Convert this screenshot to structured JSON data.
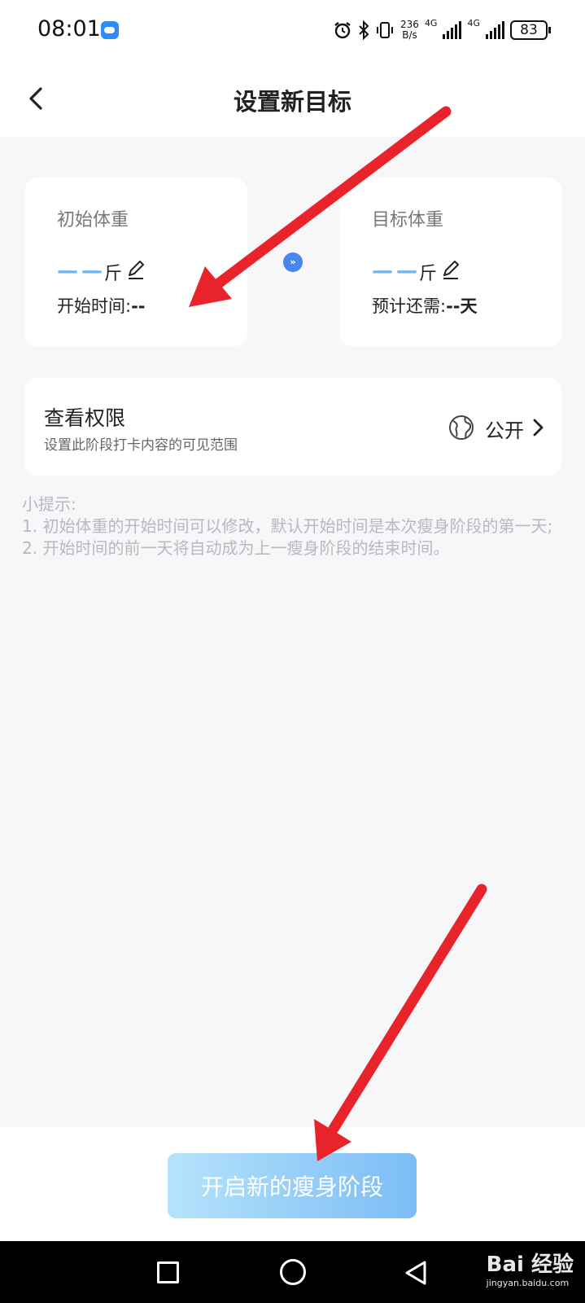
{
  "status_bar": {
    "time": "08:01",
    "net_speed_value": "236",
    "net_speed_unit": "B/s",
    "network_1": "4G",
    "network_2": "4G",
    "battery": "83"
  },
  "header": {
    "title": "设置新目标"
  },
  "initial_weight": {
    "label": "初始体重",
    "value": "——",
    "unit": "斤",
    "start_time_label": "开始时间:",
    "start_time_value": "--"
  },
  "target_weight": {
    "label": "目标体重",
    "value": "——",
    "unit": "斤",
    "remaining_label": "预计还需:",
    "remaining_value": "--天"
  },
  "permission": {
    "title": "查看权限",
    "description": "设置此阶段打卡内容的可见范围",
    "value": "公开"
  },
  "tips": {
    "heading": "小提示:",
    "line1": "1. 初始体重的开始时间可以修改，默认开始时间是本次瘦身阶段的第一天;",
    "line2": "2. 开始时间的前一天将自动成为上一瘦身阶段的结束时间。"
  },
  "start_button": {
    "label": "开启新的瘦身阶段"
  },
  "watermark": {
    "main": "Bai 经验",
    "sub": "jingyan.baidu.com"
  },
  "colors": {
    "accent": "#4a86f0",
    "dash": "#6fb5ee",
    "button_start": "#b5e3fb",
    "button_end": "#7cbcf5",
    "annotation_arrow": "#e8242a"
  }
}
